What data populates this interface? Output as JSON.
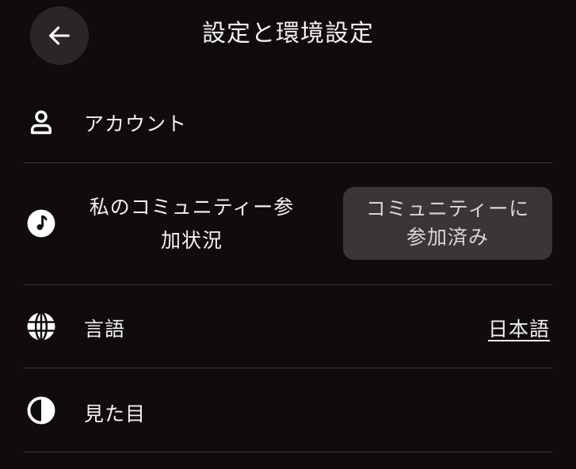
{
  "header": {
    "back_icon": "arrow-left-icon",
    "title": "設定と環境設定"
  },
  "settings": {
    "account": {
      "icon": "user-icon",
      "label": "アカウント"
    },
    "community": {
      "icon": "music-note-icon",
      "label": "私のコミュニティー参加状況",
      "status": "コミュニティーに参加済み"
    },
    "language": {
      "icon": "globe-icon",
      "label": "言語",
      "value": "日本語"
    },
    "appearance": {
      "icon": "contrast-icon",
      "label": "見た目"
    }
  },
  "colors": {
    "background": "#100b0c",
    "back_button": "#2a2526",
    "chip": "#3b3536",
    "divider": "#3a3536",
    "text": "#f2f2f2"
  }
}
